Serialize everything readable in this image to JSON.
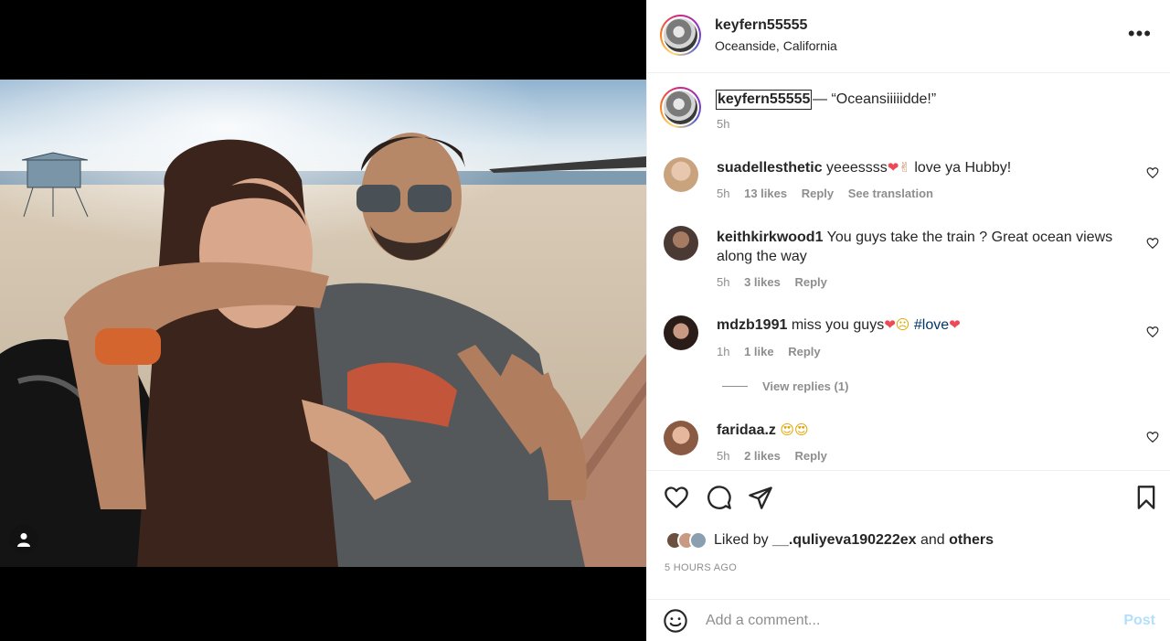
{
  "post": {
    "username": "keyfern55555",
    "location": "Oceanside, California",
    "more_icon": "more-horizontal-icon"
  },
  "caption": {
    "username": "keyfern55555",
    "text": "— “Oceansiiiiidde!”",
    "time": "5h"
  },
  "comments": [
    {
      "username": "suadellesthetic",
      "text": " yeeessss",
      "emoji": "❤✌",
      "text_after": " love ya Hubby!",
      "time": "5h",
      "likes": "13 likes",
      "reply": "Reply",
      "translate": "See translation",
      "avatar_color": "#c9a27e"
    },
    {
      "username": "keithkirkwood1",
      "text": " You guys take the train ? Great ocean views along the way",
      "time": "5h",
      "likes": "3 likes",
      "reply": "Reply",
      "avatar_color": "#6b4f3f"
    },
    {
      "username": "mdzb1991",
      "text": " miss you guys",
      "emoji": "❤☹",
      "hashtag": "#love",
      "emoji_after": "❤",
      "time": "1h",
      "likes": "1 like",
      "reply": "Reply",
      "avatar_color": "#3b2a25"
    },
    {
      "username": "faridaa.z",
      "text": " ",
      "emoji": "😍😍",
      "time": "5h",
      "likes": "2 likes",
      "reply": "Reply",
      "avatar_color": "#b98a73"
    }
  ],
  "view_replies": "View replies (1)",
  "likes": {
    "prefix": "Liked by ",
    "user": "__.quliyeva190222ex",
    "middle": " and ",
    "others": "others"
  },
  "posted_ago": "5 HOURS AGO",
  "comment_box": {
    "placeholder": "Add a comment...",
    "post_label": "Post"
  },
  "colors": {
    "link": "#00376b",
    "muted": "#8e8e8e",
    "post_disabled": "#b2dffc",
    "heart_red": "#ed4956"
  },
  "icons": [
    "heart-icon",
    "comment-icon",
    "share-icon",
    "bookmark-icon",
    "emoji-icon",
    "user-tag-icon"
  ]
}
